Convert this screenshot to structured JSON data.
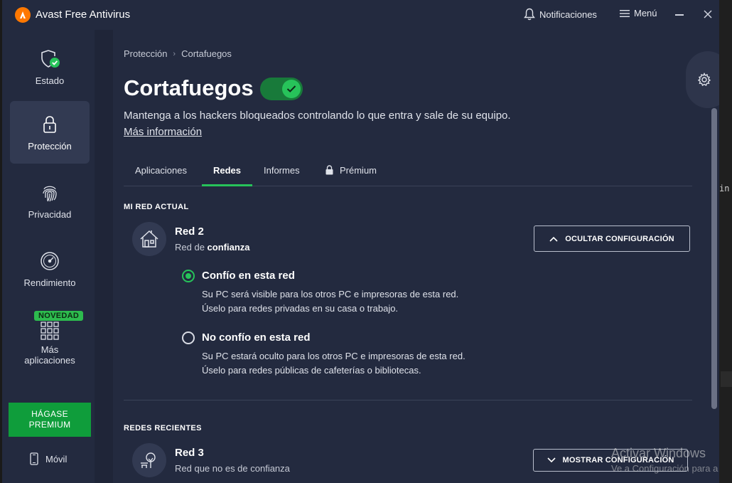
{
  "titlebar": {
    "app_title": "Avast Free Antivirus",
    "notifications_label": "Notificaciones",
    "menu_label": "Menú"
  },
  "sidebar": {
    "items": [
      {
        "label": "Estado",
        "icon": "shield-check-icon"
      },
      {
        "label": "Protección",
        "icon": "lock-icon",
        "active": true
      },
      {
        "label": "Privacidad",
        "icon": "fingerprint-icon"
      },
      {
        "label": "Rendimiento",
        "icon": "gauge-icon"
      },
      {
        "label": "Más aplicaciones",
        "icon": "apps-grid-icon",
        "badge": "NOVEDAD"
      }
    ],
    "premium_button": "HÁGASE PREMIUM",
    "mobile_label": "Móvil"
  },
  "main": {
    "breadcrumb": [
      "Protección",
      "Cortafuegos"
    ],
    "title": "Cortafuegos",
    "toggle_on": true,
    "description": "Mantenga a los hackers bloqueados controlando lo que entra y sale de su equipo.",
    "more_info": "Más información",
    "tabs": [
      {
        "label": "Aplicaciones"
      },
      {
        "label": "Redes",
        "active": true
      },
      {
        "label": "Informes"
      },
      {
        "label": "Prémium",
        "icon": "lock-icon"
      }
    ],
    "current_network": {
      "heading": "MI RED ACTUAL",
      "name": "Red 2",
      "status_prefix": "Red de",
      "status_strong": "confianza",
      "button": "OCULTAR CONFIGURACIÓN",
      "options": [
        {
          "title": "Confío en esta red",
          "lines": [
            "Su PC será visible para los otros PC e impresoras de esta red.",
            "Úselo para redes privadas en su casa o trabajo."
          ],
          "selected": true
        },
        {
          "title": "No confío en esta red",
          "lines": [
            "Su PC estará oculto para los otros PC e impresoras de esta red.",
            "Úselo para redes públicas de cafeterías o bibliotecas."
          ],
          "selected": false
        }
      ]
    },
    "recent_networks": {
      "heading": "REDES RECIENTES",
      "items": [
        {
          "name": "Red 3",
          "status": "Red que no es de confianza",
          "button": "MOSTRAR CONFIGURACIÓN"
        }
      ]
    }
  },
  "watermark": {
    "line1": "Activar Windows",
    "line2": "Ve a Configuración para a"
  },
  "desktop_fragment": "in",
  "colors": {
    "background": "#232a3f",
    "accent_green": "#27c35a",
    "brand_orange": "#ff7800",
    "premium_green": "#0f9d3b"
  }
}
